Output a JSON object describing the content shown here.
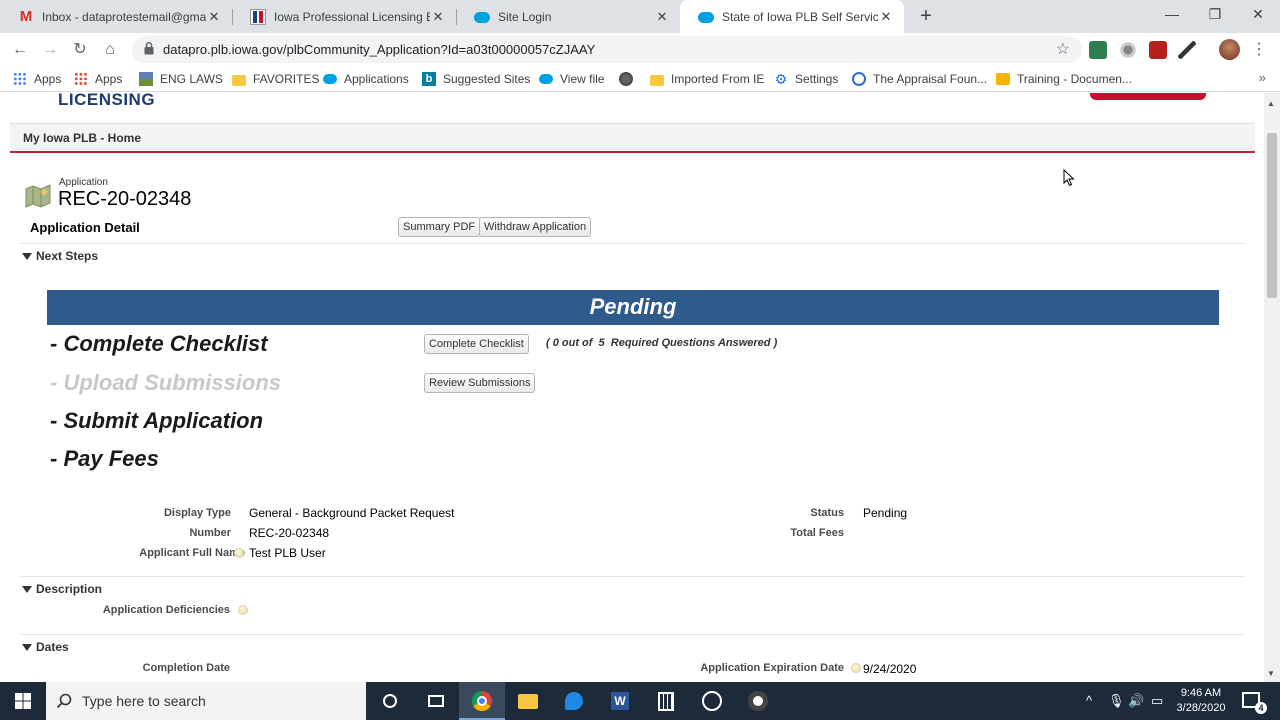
{
  "browser": {
    "tabs": [
      {
        "title": "Inbox - dataprotestemail@gmail.",
        "icon": "gmail-icon",
        "active": false
      },
      {
        "title": "Iowa Professional Licensing Bure",
        "icon": "iowa-flag-icon",
        "active": false
      },
      {
        "title": "Site Login",
        "icon": "salesforce-icon",
        "active": false
      },
      {
        "title": "State of Iowa PLB Self Service",
        "icon": "salesforce-icon",
        "active": true
      }
    ],
    "url": "datapro.plb.iowa.gov/plbCommunity_Application?Id=a03t00000057cZJAAY",
    "bookmarks": [
      {
        "label": "Apps",
        "icon": "apps-grid-icon"
      },
      {
        "label": "Apps",
        "icon": "apps-grid-icon"
      },
      {
        "label": "ENG LAWS",
        "icon": "image-icon"
      },
      {
        "label": "FAVORITES",
        "icon": "folder-icon"
      },
      {
        "label": "Applications",
        "icon": "salesforce-icon"
      },
      {
        "label": "Suggested Sites",
        "icon": "bing-icon"
      },
      {
        "label": "View file",
        "icon": "salesforce-icon"
      },
      {
        "label": "",
        "icon": "globe-icon"
      },
      {
        "label": "Imported From IE",
        "icon": "folder-icon"
      },
      {
        "label": "Settings",
        "icon": "gear-icon"
      },
      {
        "label": "The Appraisal Foun...",
        "icon": "appraisal-icon"
      },
      {
        "label": "Training - Documen...",
        "icon": "slides-icon"
      }
    ]
  },
  "page": {
    "brand_fragment": "LICENSING",
    "home_title": "My Iowa PLB - Home",
    "app_label": "Application",
    "app_number": "REC-20-02348",
    "detail_title": "Application Detail",
    "summary_pdf": "Summary PDF",
    "withdraw": "Withdraw Application",
    "next_steps": "Next Steps",
    "status_banner": "Pending",
    "steps": [
      {
        "label": "- Complete Checklist",
        "enabled": true
      },
      {
        "label": "- Upload Submissions",
        "enabled": false
      },
      {
        "label": "- Submit Application",
        "enabled": true
      },
      {
        "label": "- Pay Fees",
        "enabled": true
      }
    ],
    "complete_checklist_btn": "Complete Checklist",
    "review_submissions_btn": "Review Submissions",
    "checklist_note": "( 0 out of  5  Required Questions Answered )",
    "fields": {
      "display_type_label": "Display Type",
      "display_type_value": "General - Background Packet Request",
      "number_label": "Number",
      "number_value": "REC-20-02348",
      "applicant_label": "Applicant Full Name",
      "applicant_value": "Test PLB User",
      "status_label": "Status",
      "status_value": "Pending",
      "total_fees_label": "Total Fees",
      "total_fees_value": ""
    },
    "description_heading": "Description",
    "deficiencies_label": "Application Deficiencies",
    "dates_heading": "Dates",
    "completion_date_label": "Completion Date",
    "expiration_label": "Application Expiration Date",
    "expiration_value": "9/24/2020"
  },
  "taskbar": {
    "search_placeholder": "Type here to search",
    "time": "9:46 AM",
    "date": "3/28/2020",
    "notification_count": "4"
  }
}
